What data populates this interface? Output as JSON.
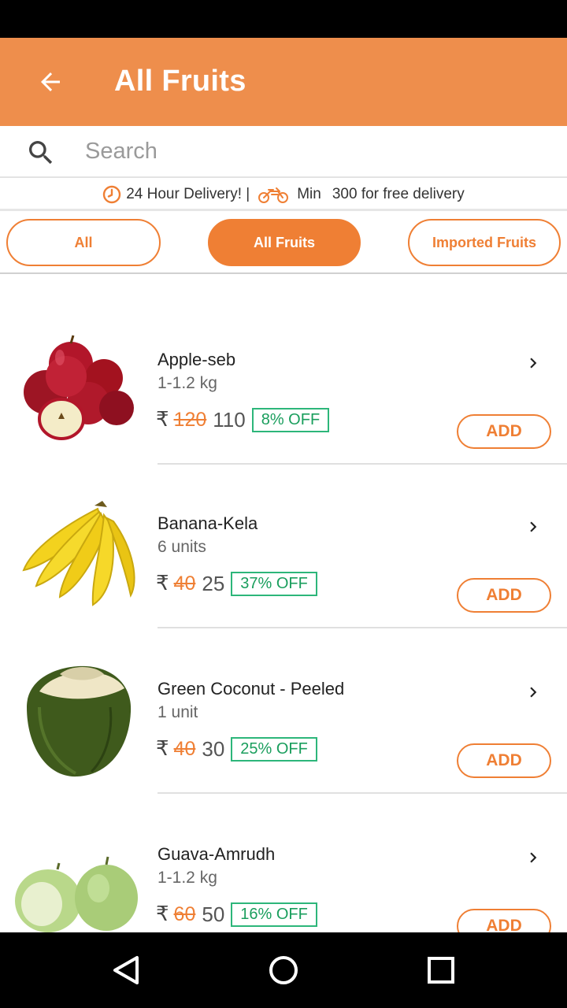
{
  "app_bar": {
    "title": "All Fruits",
    "back_icon": "arrow-left-icon",
    "background": "#ee8e4c"
  },
  "search": {
    "placeholder": "Search",
    "value": ""
  },
  "delivery": {
    "text_24h": "24 Hour Delivery! |",
    "min_label": "Min",
    "min_text": "300 for free delivery"
  },
  "chips": [
    {
      "label": "All",
      "active": false
    },
    {
      "label": "All Fruits",
      "active": true
    },
    {
      "label": "Imported Fruits",
      "active": false
    }
  ],
  "products": [
    {
      "name": "Apple-seb",
      "qty": "1-1.2 kg",
      "currency": "₹",
      "mrp": "120",
      "price": "110",
      "discount": "8% OFF",
      "add_label": "ADD"
    },
    {
      "name": "Banana-Kela",
      "qty": "6 units",
      "currency": "₹",
      "mrp": "40",
      "price": "25",
      "discount": "37% OFF",
      "add_label": "ADD"
    },
    {
      "name": "Green Coconut - Peeled",
      "qty": "1 unit",
      "currency": "₹",
      "mrp": "40",
      "price": "30",
      "discount": "25% OFF",
      "add_label": "ADD"
    },
    {
      "name": "Guava-Amrudh",
      "qty": "1-1.2 kg",
      "currency": "₹",
      "mrp": "60",
      "price": "50",
      "discount": "16% OFF",
      "add_label": "ADD"
    }
  ],
  "colors": {
    "accent": "#ef7f34",
    "discount": "#2db67a"
  }
}
